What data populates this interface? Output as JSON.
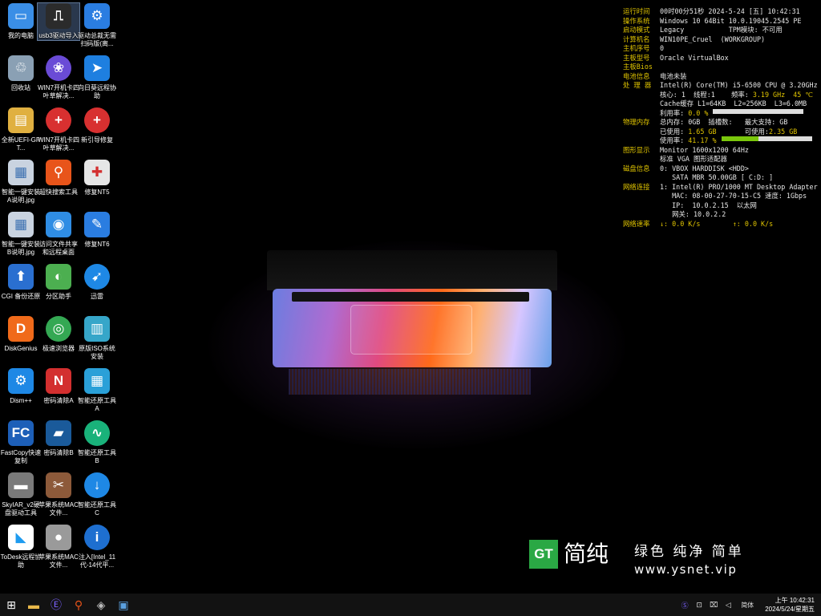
{
  "desktop": {
    "icons": [
      {
        "label": "我的电脑",
        "icon": "computer-icon",
        "color": "#3a8ee6"
      },
      {
        "label": "usb3驱动导入",
        "icon": "usb-icon",
        "color": "#2b2b2b"
      },
      {
        "label": "驱动总裁无需扫码版(离...",
        "icon": "driver-gear-icon",
        "color": "#2a7de1"
      },
      {
        "label": "回收站",
        "icon": "recycle-bin-icon",
        "color": "#8aa0b4"
      },
      {
        "label": "WIN7开机卡四叶草解决...",
        "icon": "clover-fix-icon",
        "color": "#6a4bd6"
      },
      {
        "label": "向日葵远程协助",
        "icon": "sunflower-remote-icon",
        "color": "#1e7fe0"
      },
      {
        "label": "全新UEFI-GPT...",
        "icon": "document-icon",
        "color": "#e0b040"
      },
      {
        "label": "WIN7开机卡四叶草解决...",
        "icon": "red-plus-icon",
        "color": "#d83030"
      },
      {
        "label": "新引导修复",
        "icon": "red-plus-icon",
        "color": "#d83030"
      },
      {
        "label": "智能一键安装A说明.jpg",
        "icon": "image-file-icon",
        "color": "#c9d3e0"
      },
      {
        "label": "超快搜索工具",
        "icon": "search-tool-icon",
        "color": "#e8541a"
      },
      {
        "label": "修复NT5",
        "icon": "medical-kit-icon",
        "color": "#e6e6e6"
      },
      {
        "label": "智能一键安装B说明.jpg",
        "icon": "image-file-icon",
        "color": "#c9d3e0"
      },
      {
        "label": "访问文件共享和远程桌面",
        "icon": "network-share-icon",
        "color": "#2f8de4"
      },
      {
        "label": "修复NT6",
        "icon": "wrench-icon",
        "color": "#2a7de1"
      },
      {
        "label": "CGI 备份还原",
        "icon": "backup-icon",
        "color": "#2a6fd0"
      },
      {
        "label": "分区助手",
        "icon": "partition-icon",
        "color": "#4caf50"
      },
      {
        "label": "迅雷",
        "icon": "thunder-icon",
        "color": "#1e88e5"
      },
      {
        "label": "DiskGenius",
        "icon": "diskgenius-icon",
        "color": "#f06a1a"
      },
      {
        "label": "极速浏览器",
        "icon": "browser-icon",
        "color": "#34a853"
      },
      {
        "label": "原版ISO系统安装",
        "icon": "iso-book-icon",
        "color": "#36a6c9"
      },
      {
        "label": "Dism++",
        "icon": "dism-gear-icon",
        "color": "#1e88e5"
      },
      {
        "label": "密码清除A",
        "icon": "password-clear-icon",
        "color": "#d32f2f"
      },
      {
        "label": "智能还原工具A",
        "icon": "restore-grid-icon",
        "color": "#2aa0d8"
      },
      {
        "label": "FastCopy快速复制",
        "icon": "fastcopy-icon",
        "color": "#1d5fb8"
      },
      {
        "label": "密码清除B",
        "icon": "key-folder-icon",
        "color": "#1a5a9a"
      },
      {
        "label": "智能还原工具B",
        "icon": "restore-chart-icon",
        "color": "#19b27a"
      },
      {
        "label": "SkyIAR_v2硬盘驱动工具",
        "icon": "disk-drive-icon",
        "color": "#7a7a7a"
      },
      {
        "label": "苹果系统MAC文件...",
        "icon": "mac-file-icon",
        "color": "#8d5a3a"
      },
      {
        "label": "智能还原工具C",
        "icon": "download-arrow-icon",
        "color": "#1e88e5"
      },
      {
        "label": "ToDesk远程协助",
        "icon": "todesk-icon",
        "color": "#ffffff"
      },
      {
        "label": "苹果系统MAC文件...",
        "icon": "apple-icon",
        "color": "#9a9a9a"
      },
      {
        "label": "注入[Intel_11代-14代平...",
        "icon": "intel-icon",
        "color": "#1e6fd0"
      }
    ]
  },
  "sysinfo": {
    "rows": [
      {
        "key": "运行时间",
        "value": "00时00分51秒 2024-5-24 [五] 10:42:31"
      },
      {
        "key": "操作系统",
        "value": "Windows 10 64Bit 10.0.19045.2545 PE"
      },
      {
        "key": "启动模式",
        "value": "Legacy           TPM模块: 不可用"
      },
      {
        "key": "计算机名",
        "value": "WIN10PE_Cruel  (WORKGROUP)"
      },
      {
        "key": "主机序号",
        "value": "0"
      },
      {
        "key": "主板型号",
        "value": "Oracle VirtualBox"
      },
      {
        "key": "主板Bios",
        "value": ""
      },
      {
        "key": "电池信息",
        "value": "电池未装"
      },
      {
        "key": "处 理 器",
        "value": "Intel(R) Core(TM) i5-6500 CPU @ 3.20GHz"
      },
      {
        "key": "",
        "value": "核心: 1  线程:1    频率: ",
        "hl": "3.19 GHz  45 ℃"
      },
      {
        "key": "",
        "value": "Cache缓存 L1=64KB  L2=256KB  L3=6.0MB"
      },
      {
        "key": "",
        "value": "利用率: ",
        "hl": "0.0 %",
        "bar": 0.0
      },
      {
        "key": "物理内存",
        "value": "总内存: 0GB  插槽数:   最大支持: GB"
      },
      {
        "key": "",
        "value": "已使用: ",
        "hl": "1.65 GB",
        "tail": "       可使用:",
        "tailhl": "2.35 GB"
      },
      {
        "key": "",
        "value": "使用率: ",
        "hl": "41.17 %",
        "bar": 0.4117
      },
      {
        "key": "图形显示",
        "value": "Monitor 1600x1200 64Hz"
      },
      {
        "key": "",
        "value": "标准 VGA 图形适配器"
      },
      {
        "key": "磁盘信息",
        "value": "0: VBOX HARDDISK <HDD>"
      },
      {
        "key": "",
        "value": "   SATA MBR 50.00GB [ C:D: ]"
      },
      {
        "key": "网络连接",
        "value": "1: Intel(R) PRO/1000 MT Desktop Adapter"
      },
      {
        "key": "",
        "value": "   MAC: 08-00-27-70-15-C5 速度: 1Gbps"
      },
      {
        "key": "",
        "value": "   IP:  10.0.2.15  以太网"
      },
      {
        "key": "",
        "value": "   网关: 10.0.2.2"
      },
      {
        "key": "网络速率",
        "value": "",
        "hl": "↓: 0.0 K/s        ↑: 0.0 K/s"
      }
    ]
  },
  "brand": {
    "logo": "GT",
    "name": "简纯",
    "slogan": "绿色 纯净 简单",
    "url": "www.ysnet.vip"
  },
  "taskbar": {
    "buttons": [
      {
        "name": "start-button",
        "glyph": "⊞",
        "color": "#ffffff"
      },
      {
        "name": "file-explorer-button",
        "glyph": "▬",
        "color": "#e8b84a"
      },
      {
        "name": "tool-e-button",
        "glyph": "Ⓔ",
        "color": "#7b61ff"
      },
      {
        "name": "search-tool-button",
        "glyph": "⚲",
        "color": "#e8541a"
      },
      {
        "name": "device-manager-button",
        "glyph": "◈",
        "color": "#bbbbbb"
      },
      {
        "name": "monitor-button",
        "glyph": "▣",
        "color": "#5aa0e0"
      }
    ],
    "tray": {
      "ime_icon": "Ⓢ",
      "network_icon": "⊡",
      "device_icon": "⌧",
      "volume_icon": "◁",
      "language": "简体",
      "time": "上午 10:42:31",
      "date": "2024/5/24/星期五"
    }
  }
}
